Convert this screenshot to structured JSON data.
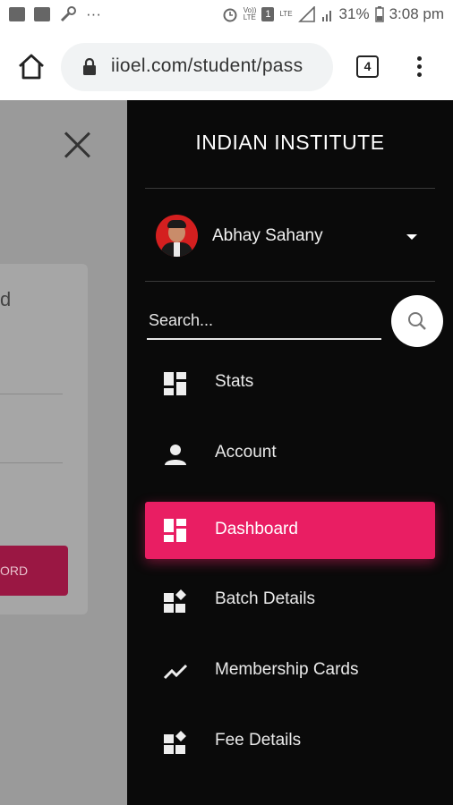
{
  "status_bar": {
    "battery": "31%",
    "time": "3:08 pm",
    "net1": "Vo))",
    "net1b": "LTE",
    "net2": "LTE",
    "sim": "1"
  },
  "browser": {
    "url": "iioel.com/student/pass",
    "tab_count": "4"
  },
  "background_page": {
    "label_partial": "d",
    "button_partial": "ORD"
  },
  "drawer": {
    "title": "INDIAN INSTITUTE",
    "user_name": "Abhay Sahany",
    "search_placeholder": "Search...",
    "nav": [
      {
        "label": "Stats",
        "icon": "dashboard-grid-icon"
      },
      {
        "label": "Account",
        "icon": "person-icon"
      },
      {
        "label": "Dashboard",
        "icon": "dashboard-grid-icon"
      },
      {
        "label": "Batch Details",
        "icon": "widgets-icon"
      },
      {
        "label": "Membership Cards",
        "icon": "trending-line-icon"
      },
      {
        "label": "Fee Details",
        "icon": "widgets-icon"
      }
    ],
    "active_index": 2,
    "accent_color": "#e91e63"
  }
}
